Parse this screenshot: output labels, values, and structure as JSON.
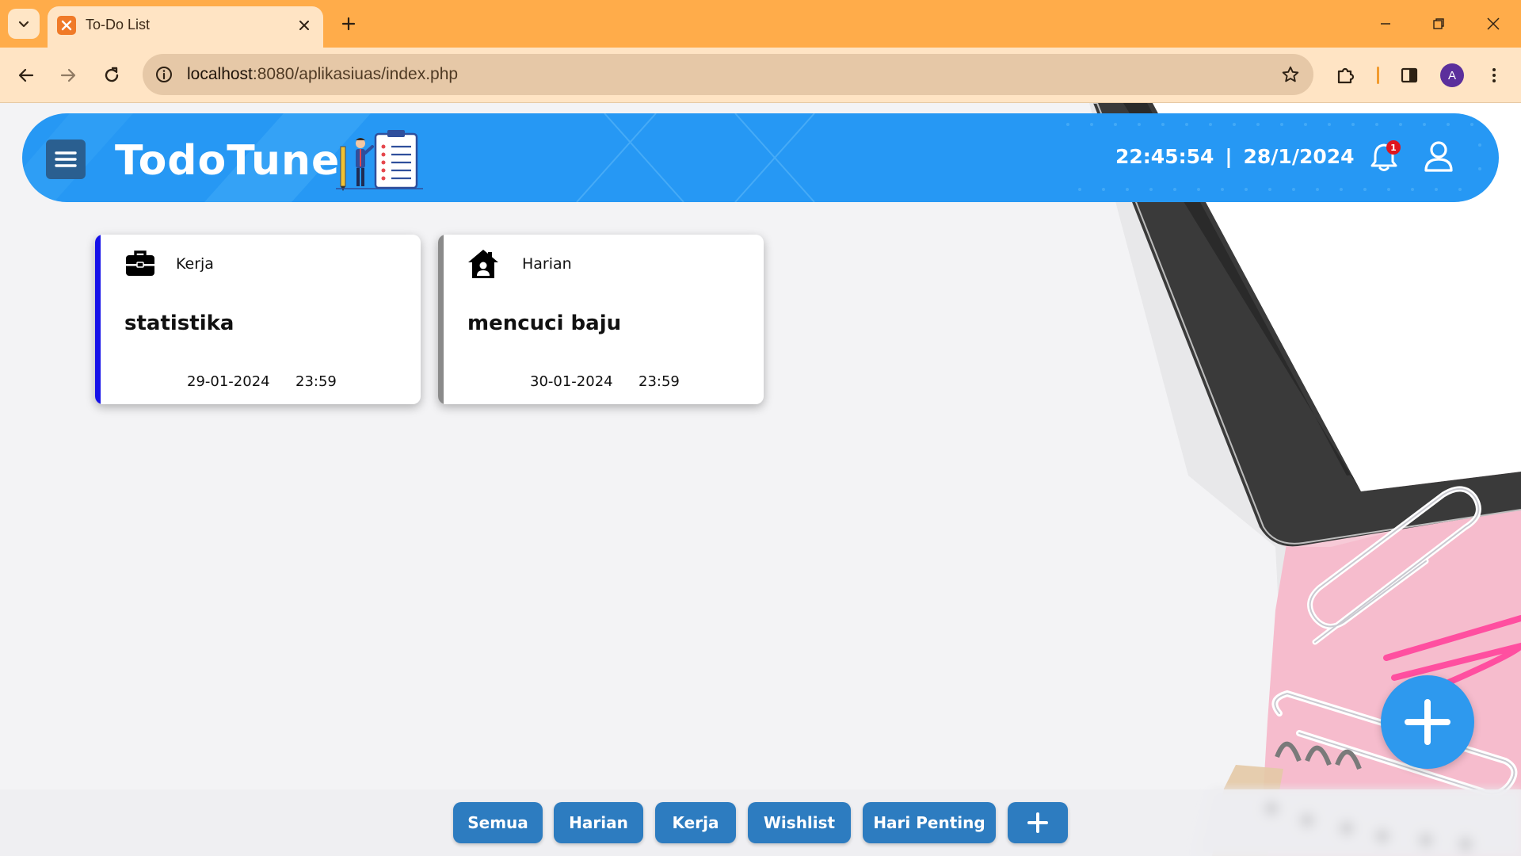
{
  "browser": {
    "tab_title": "To-Do List",
    "url_host": "localhost",
    "url_path": ":8080/aplikasiuas/index.php",
    "profile_initial": "A",
    "tabbar_color": "#ffac4a",
    "toolbar_color": "#ffe4c4"
  },
  "app": {
    "brand": "TodoTune",
    "time": "22:45:54",
    "separator": "|",
    "date": "28/1/2024",
    "notification_count": "1",
    "header_color": "#2698f4",
    "icons": [
      "hamburger-menu-icon",
      "clipboard-illustration",
      "bell-icon",
      "user-icon"
    ]
  },
  "tasks": [
    {
      "category": "Kerja",
      "icon": "briefcase-icon",
      "title": "statistika",
      "date": "29-01-2024",
      "time": "23:59",
      "accent": "#1611e8"
    },
    {
      "category": "Harian",
      "icon": "house-icon",
      "title": "mencuci baju",
      "date": "30-01-2024",
      "time": "23:59",
      "accent": "#8a8a8a"
    }
  ],
  "filters": [
    "Semua",
    "Harian",
    "Kerja",
    "Wishlist",
    "Hari Penting"
  ],
  "filter_button_color": "#2d7cc0",
  "fab_icon": "plus-icon",
  "fab_color": "#2e99ee"
}
